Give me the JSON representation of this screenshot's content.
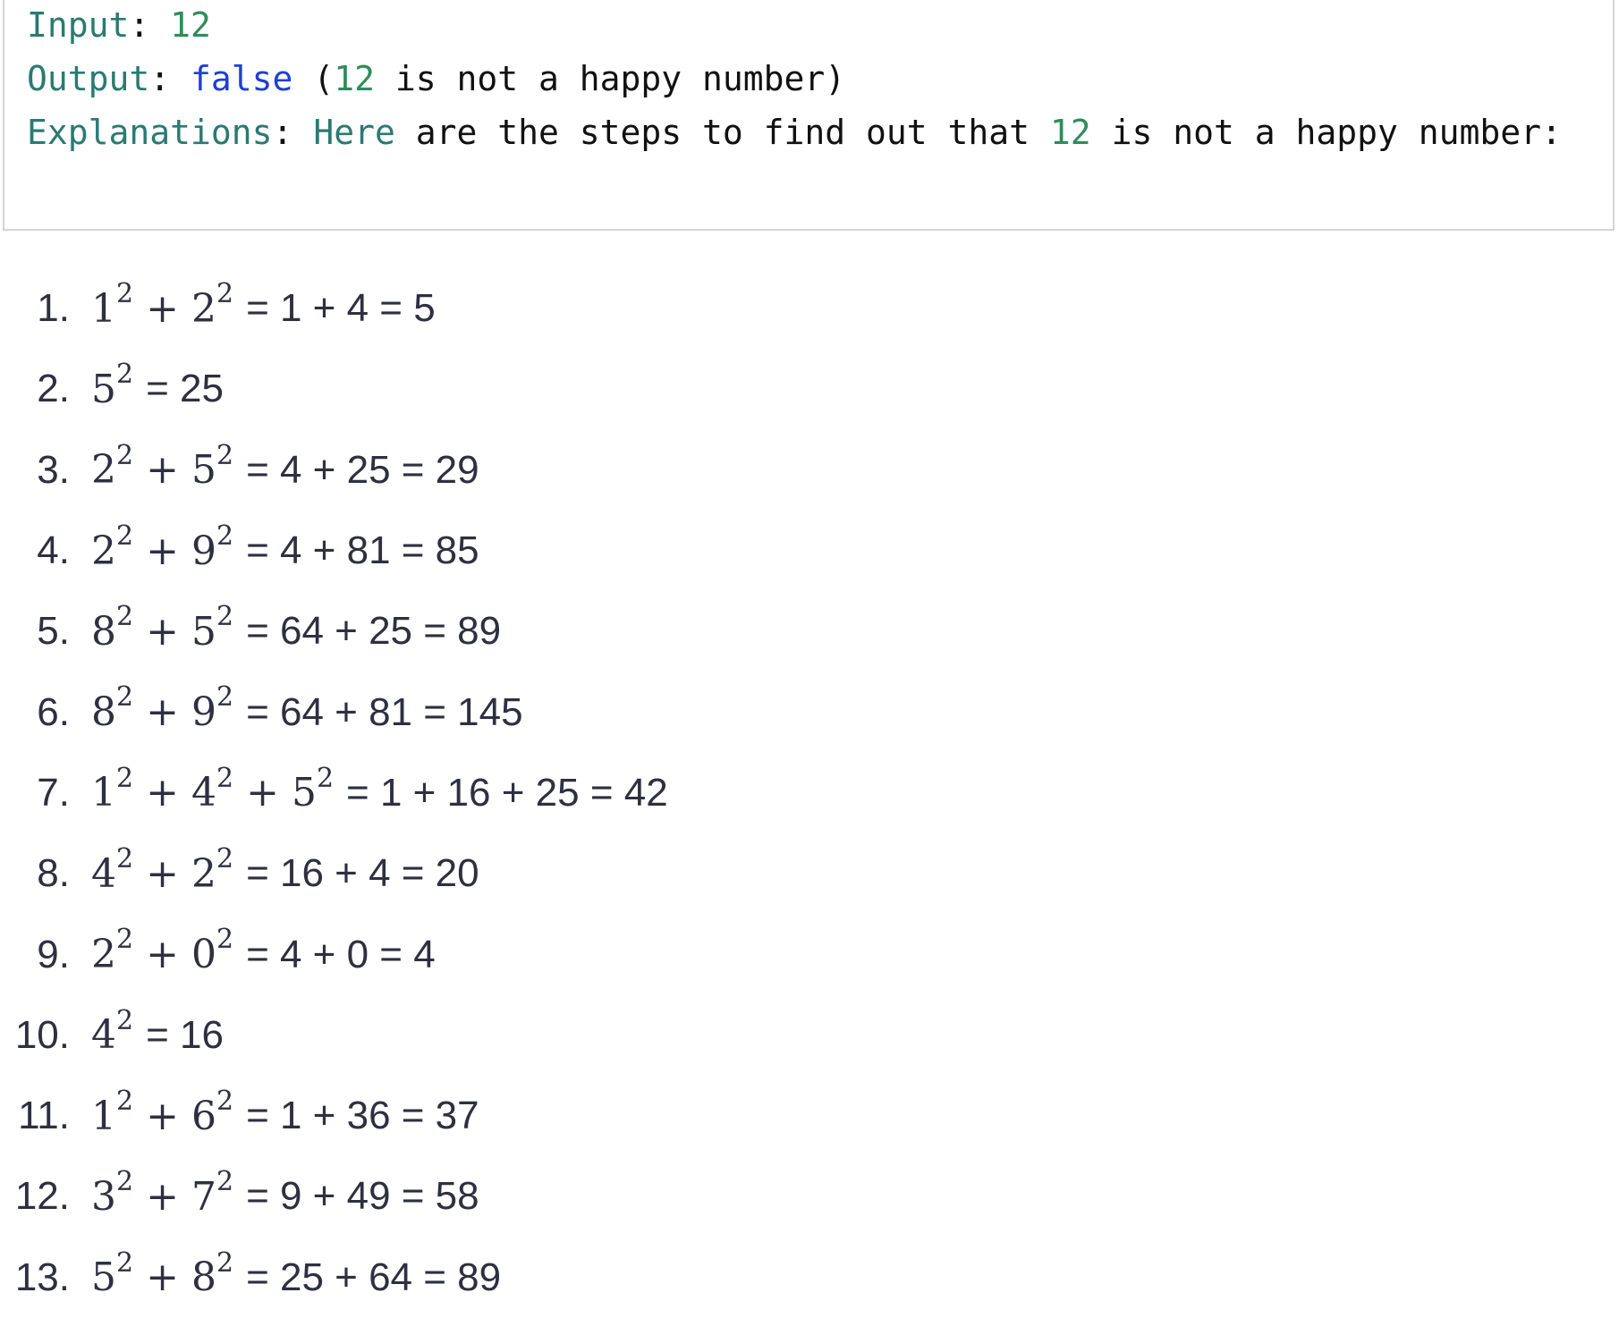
{
  "code_block": {
    "input_label": "Input",
    "input_value": "12",
    "output_label": "Output",
    "output_value": "false",
    "output_paren_open": " (",
    "output_num": "12",
    "output_rest": " is not a happy number)",
    "explanation_label": "Explanations",
    "explanation_here": "Here",
    "explanation_mid": " are the steps to find out that ",
    "explanation_num": "12",
    "explanation_tail": " is not a happy number:"
  },
  "steps": [
    {
      "index": "1.",
      "terms": [
        "1",
        "2"
      ],
      "result": "= 1 + 4 = 5"
    },
    {
      "index": "2.",
      "terms": [
        "5"
      ],
      "result": "= 25"
    },
    {
      "index": "3.",
      "terms": [
        "2",
        "5"
      ],
      "result": "= 4 + 25 = 29"
    },
    {
      "index": "4.",
      "terms": [
        "2",
        "9"
      ],
      "result": "= 4 + 81 = 85"
    },
    {
      "index": "5.",
      "terms": [
        "8",
        "5"
      ],
      "result": "= 64 + 25 = 89"
    },
    {
      "index": "6.",
      "terms": [
        "8",
        "9"
      ],
      "result": "= 64 + 81 = 145"
    },
    {
      "index": "7.",
      "terms": [
        "1",
        "4",
        "5"
      ],
      "result": "= 1 + 16 + 25 = 42"
    },
    {
      "index": "8.",
      "terms": [
        "4",
        "2"
      ],
      "result": "= 16 + 4 = 20"
    },
    {
      "index": "9.",
      "terms": [
        "2",
        "0"
      ],
      "result": "= 4 + 0 = 4"
    },
    {
      "index": "10.",
      "terms": [
        "4"
      ],
      "result": "= 16"
    },
    {
      "index": "11.",
      "terms": [
        "1",
        "6"
      ],
      "result": "= 1 + 36 = 37"
    },
    {
      "index": "12.",
      "terms": [
        "3",
        "7"
      ],
      "result": "= 9 + 49 = 58"
    },
    {
      "index": "13.",
      "terms": [
        "5",
        "8"
      ],
      "result": "= 25 + 64 = 89"
    }
  ],
  "exponent": "2",
  "plus": "+",
  "colors": {
    "keyword": "#2a7a72",
    "number": "#2f8c5a",
    "boolean": "#1f3fd6",
    "text": "#2e3040"
  }
}
